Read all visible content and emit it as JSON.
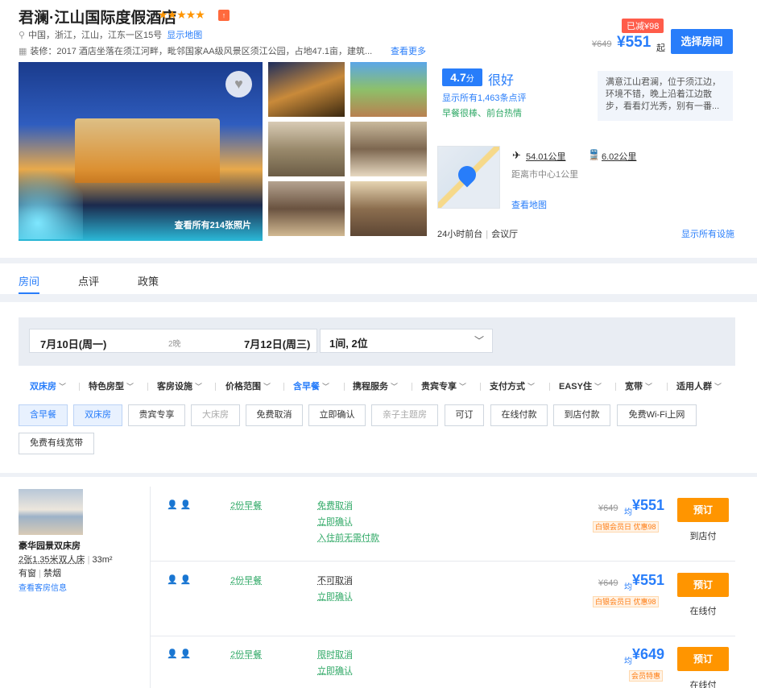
{
  "hotel": {
    "name": "君澜·江山国际度假酒店",
    "stars": "★★★★★",
    "medal": "↑",
    "address": "中国，浙江，江山，江东一区15号",
    "show_map": "显示地图",
    "intro": "装修：2017  酒店坐落在须江河畔，毗邻国家AA级风景区须江公园，占地47.1亩，建筑...",
    "more": "查看更多"
  },
  "price_top": {
    "discount_badge": "已减¥98",
    "old_price": "¥649",
    "new_price": "¥551",
    "qi": "起",
    "select_button": "选择房间"
  },
  "gallery": {
    "photos_count": "查看所有214张照片"
  },
  "review": {
    "score": "4.7",
    "score_unit": "分",
    "score_word": "很好",
    "review_link": "显示所有1,463条点评",
    "tags": "早餐很棒、前台热情",
    "quote": "满意江山君澜，位于须江边，环境不错，晚上沿着江边散步，看看灯光秀，别有一番..."
  },
  "location": {
    "airport_dist": "54.01公里",
    "train_dist": "6.02公里",
    "center_dist": "距离市中心1公里",
    "map_link": "查看地图",
    "facilities": [
      "24小时前台",
      "会议厅"
    ],
    "all_facilities": "显示所有设施"
  },
  "tabs": [
    "房间",
    "点评",
    "政策"
  ],
  "search": {
    "checkin": "7月10日(周一)",
    "nights": "2晚",
    "checkout": "7月12日(周三)",
    "guests": "1间, 2位"
  },
  "filters": [
    {
      "label": "双床房",
      "on": true
    },
    {
      "label": "特色房型",
      "on": false
    },
    {
      "label": "客房设施",
      "on": false
    },
    {
      "label": "价格范围",
      "on": false
    },
    {
      "label": "含早餐",
      "on": true
    },
    {
      "label": "携程服务",
      "on": false
    },
    {
      "label": "贵宾专享",
      "on": false
    },
    {
      "label": "支付方式",
      "on": false
    },
    {
      "label": "EASY住",
      "on": false
    },
    {
      "label": "宽带",
      "on": false
    },
    {
      "label": "适用人群",
      "on": false
    }
  ],
  "chips": [
    {
      "label": "含早餐",
      "state": "on"
    },
    {
      "label": "双床房",
      "state": "on"
    },
    {
      "label": "贵宾专享",
      "state": ""
    },
    {
      "label": "大床房",
      "state": "dis"
    },
    {
      "label": "免费取消",
      "state": ""
    },
    {
      "label": "立即确认",
      "state": ""
    },
    {
      "label": "亲子主题房",
      "state": "dis"
    },
    {
      "label": "可订",
      "state": ""
    },
    {
      "label": "在线付款",
      "state": ""
    },
    {
      "label": "到店付款",
      "state": ""
    },
    {
      "label": "免费Wi-Fi上网",
      "state": ""
    },
    {
      "label": "免费有线宽带",
      "state": ""
    }
  ],
  "room": {
    "name": "豪华园景双床房",
    "bed": "2张1.35米双人床",
    "size": "33m²",
    "window": "有窗",
    "smoke": "禁烟",
    "info_link": "查看客房信息"
  },
  "rates": [
    {
      "people": "👤👤",
      "meal": "2份早餐",
      "policies": [
        {
          "t": "免费取消",
          "c": "green"
        },
        {
          "t": "立即确认",
          "c": "green"
        },
        {
          "t": "入住前无需付款",
          "c": "green"
        }
      ],
      "old": "¥649",
      "jun": "均",
      "price": "¥551",
      "tag1": "白银会员日",
      "tag2": "优惠98",
      "book": "预订",
      "pay": "到店付"
    },
    {
      "people": "👤👤",
      "meal": "2份早餐",
      "policies": [
        {
          "t": "不可取消",
          "c": "dark"
        },
        {
          "t": "立即确认",
          "c": "green"
        }
      ],
      "old": "¥649",
      "jun": "均",
      "price": "¥551",
      "tag1": "白银会员日",
      "tag2": "优惠98",
      "book": "预订",
      "pay": "在线付"
    },
    {
      "people": "👤👤",
      "meal": "2份早餐",
      "policies": [
        {
          "t": "限时取消",
          "c": "green"
        },
        {
          "t": "立即确认",
          "c": "green"
        }
      ],
      "old": "",
      "jun": "均",
      "price": "¥649",
      "tag1": "会员特惠",
      "tag2": "",
      "book": "预订",
      "pay": "在线付"
    }
  ],
  "colors": {
    "accent": "#287dfa",
    "book": "#ff9500",
    "green": "#2ea865",
    "badge": "#ff5c4a"
  }
}
